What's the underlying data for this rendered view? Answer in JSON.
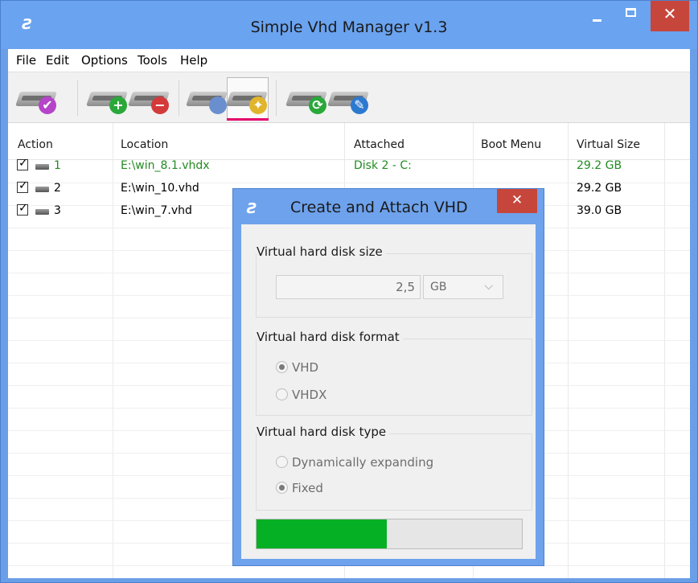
{
  "window": {
    "title": "Simple Vhd Manager v1.3"
  },
  "menu": [
    "File",
    "Edit",
    "Options",
    "Tools",
    "Help"
  ],
  "toolbar": {
    "buttons": [
      {
        "icon": "drive-check-icon",
        "badge": "✔",
        "color": "#b544c9"
      },
      {
        "icon": "drive-add-icon",
        "badge": "+",
        "color": "#2aa83a"
      },
      {
        "icon": "drive-remove-icon",
        "badge": "−",
        "color": "#d33a3a"
      },
      {
        "icon": "drive-mouse-icon",
        "badge": "",
        "color": "#6a8fcf"
      },
      {
        "icon": "drive-wizard-icon",
        "badge": "✦",
        "color": "#e0b52c"
      },
      {
        "icon": "drive-refresh-icon",
        "badge": "⟳",
        "color": "#2aa83a"
      },
      {
        "icon": "drive-settings-icon",
        "badge": "✎",
        "color": "#2c79d0"
      }
    ]
  },
  "columns": [
    "Action",
    "Location",
    "Attached",
    "Boot Menu",
    "Virtual Size"
  ],
  "rows": [
    {
      "num": "1",
      "location": "E:\\win_8.1.vhdx",
      "attached": "Disk 2  -  C:",
      "boot": "",
      "size": "29.2 GB",
      "highlight": true
    },
    {
      "num": "2",
      "location": "E:\\win_10.vhd",
      "attached": "",
      "boot": "",
      "size": "29.2 GB",
      "highlight": false
    },
    {
      "num": "3",
      "location": "E:\\win_7.vhd",
      "attached": "",
      "boot": "",
      "size": "39.0 GB",
      "highlight": false
    }
  ],
  "dialog": {
    "title": "Create and Attach VHD",
    "size_group": "Virtual hard disk size",
    "size_value": "2,5",
    "size_unit": "GB",
    "format_group": "Virtual hard disk format",
    "format_options": [
      "VHD",
      "VHDX"
    ],
    "format_selected": "VHD",
    "type_group": "Virtual hard disk type",
    "type_options": [
      "Dynamically expanding",
      "Fixed"
    ],
    "type_selected": "Fixed",
    "progress": 0.49
  },
  "colors": {
    "accent": "#6aa3ef",
    "close": "#c7463c",
    "progress": "#06b025",
    "attached_text": "#228b22"
  }
}
